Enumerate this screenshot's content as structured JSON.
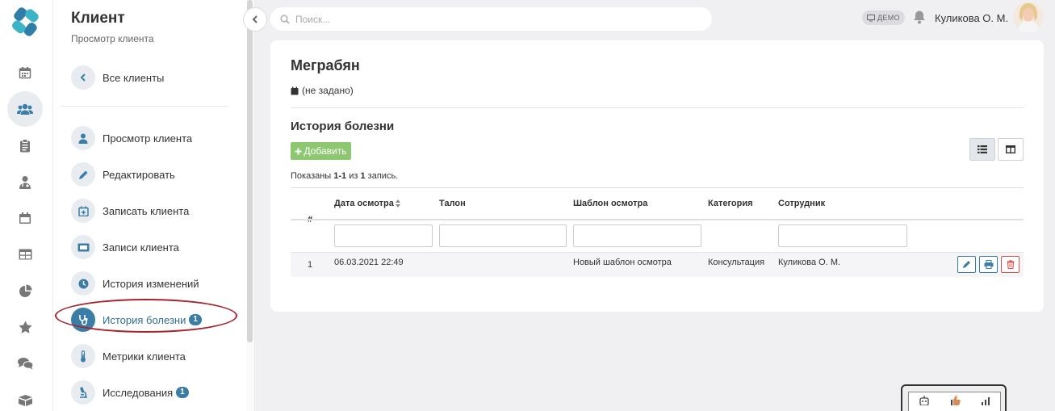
{
  "rail": {
    "items": [
      {
        "icon": "calendar-icon"
      },
      {
        "icon": "users-icon",
        "active": true
      },
      {
        "icon": "clipboard-icon"
      },
      {
        "icon": "doctor-icon"
      },
      {
        "icon": "calendar-month-icon"
      },
      {
        "icon": "table-icon"
      },
      {
        "icon": "pie-chart-icon"
      },
      {
        "icon": "star-icon"
      },
      {
        "icon": "chat-icon"
      },
      {
        "icon": "box-icon"
      }
    ]
  },
  "sidebar": {
    "title": "Клиент",
    "subtitle": "Просмотр клиента",
    "back_label": "Все клиенты",
    "items": [
      {
        "label": "Просмотр клиента",
        "icon": "user-icon"
      },
      {
        "label": "Редактировать",
        "icon": "pencil-icon"
      },
      {
        "label": "Записать клиента",
        "icon": "calendar-plus-icon"
      },
      {
        "label": "Записи клиента",
        "icon": "ticket-icon"
      },
      {
        "label": "История изменений",
        "icon": "clock-icon"
      },
      {
        "label": "История болезни",
        "icon": "stethoscope-icon",
        "badge": "1",
        "active": true
      },
      {
        "label": "Метрики клиента",
        "icon": "thermometer-icon"
      },
      {
        "label": "Исследования",
        "icon": "microscope-icon",
        "badge": "1"
      }
    ]
  },
  "header": {
    "search_placeholder": "Поиск...",
    "demo_label": "ДЕМО",
    "user_name": "Куликова О. М."
  },
  "main": {
    "client_name": "Меграбян",
    "birth_date": "(не задано)",
    "section_title": "История болезни",
    "add_label": "Добавить",
    "summary": {
      "prefix": "Показаны ",
      "range": "1-1",
      "middle": " из ",
      "total": "1",
      "suffix": " запись."
    },
    "table": {
      "columns": [
        "#",
        "Дата осмотра",
        "Талон",
        "Шаблон осмотра",
        "Категория",
        "Сотрудник"
      ],
      "rows": [
        {
          "num": "1",
          "date": "06.03.2021 22:49",
          "ticket": "",
          "template": "Новый шаблон осмотра",
          "category": "Консультация",
          "employee": "Куликова О. М."
        }
      ]
    }
  },
  "colors": {
    "accent": "#3a7ea7",
    "add_button": "#8dc870",
    "delete": "#d9534f",
    "highlight_ring": "#a8222c"
  }
}
